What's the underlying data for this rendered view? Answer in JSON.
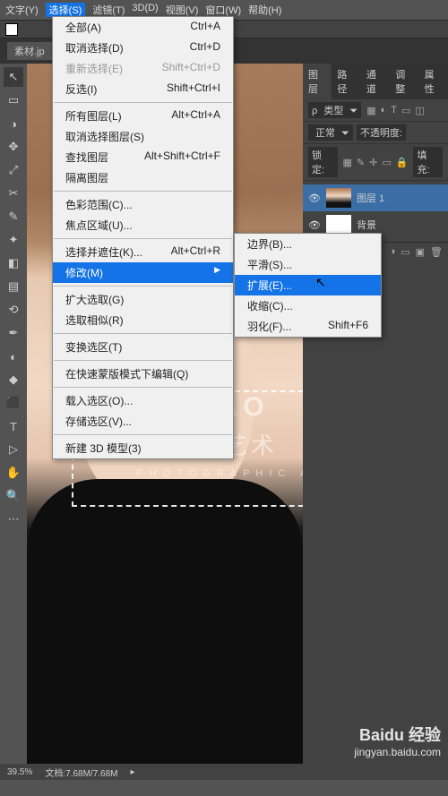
{
  "menubar": {
    "items": [
      "文字(Y)",
      "选择(S)",
      "滤镜(T)",
      "3D(D)",
      "视图(V)",
      "窗口(W)",
      "帮助(H)"
    ],
    "active_index": 1
  },
  "document_tab": "素材.jp",
  "select_menu": {
    "items": [
      {
        "label": "全部(A)",
        "shortcut": "Ctrl+A"
      },
      {
        "label": "取消选择(D)",
        "shortcut": "Ctrl+D"
      },
      {
        "label": "重新选择(E)",
        "shortcut": "Shift+Ctrl+D",
        "disabled": true
      },
      {
        "label": "反选(I)",
        "shortcut": "Shift+Ctrl+I"
      },
      {
        "sep": true
      },
      {
        "label": "所有图层(L)",
        "shortcut": "Alt+Ctrl+A"
      },
      {
        "label": "取消选择图层(S)"
      },
      {
        "label": "查找图层",
        "shortcut": "Alt+Shift+Ctrl+F"
      },
      {
        "label": "隔离图层"
      },
      {
        "sep": true
      },
      {
        "label": "色彩范围(C)..."
      },
      {
        "label": "焦点区域(U)..."
      },
      {
        "sep": true
      },
      {
        "label": "选择并遮住(K)...",
        "shortcut": "Alt+Ctrl+R"
      },
      {
        "label": "修改(M)",
        "submenu": true,
        "highlight": true
      },
      {
        "sep": true
      },
      {
        "label": "扩大选取(G)"
      },
      {
        "label": "选取相似(R)"
      },
      {
        "sep": true
      },
      {
        "label": "变换选区(T)"
      },
      {
        "sep": true
      },
      {
        "label": "在快速蒙版模式下编辑(Q)"
      },
      {
        "sep": true
      },
      {
        "label": "载入选区(O)..."
      },
      {
        "label": "存储选区(V)..."
      },
      {
        "sep": true
      },
      {
        "label": "新建 3D 模型(3)"
      }
    ]
  },
  "modify_submenu": {
    "items": [
      {
        "label": "边界(B)..."
      },
      {
        "label": "平滑(S)..."
      },
      {
        "label": "扩展(E)...",
        "highlight": true
      },
      {
        "label": "收缩(C)..."
      },
      {
        "label": "羽化(F)...",
        "shortcut": "Shift+F6"
      }
    ]
  },
  "panels": {
    "tabs": [
      "图层",
      "路径",
      "通道",
      "调整",
      "属性"
    ],
    "active_tab": 0,
    "kind_label": "类型",
    "blend_mode": "正常",
    "opacity_label": "不透明度:",
    "lock_label": "锁定:",
    "fill_label": "填充:",
    "layers": [
      {
        "name": "图层 1",
        "visible": true,
        "current": true
      },
      {
        "name": "背景",
        "visible": true,
        "current": false
      }
    ]
  },
  "watermark": {
    "line1": "IAO",
    "line2": "影艺术",
    "line3": "PHOTOGRAPHIC ART"
  },
  "status": {
    "zoom": "39.5%",
    "doc": "文档:7.68M/7.68M"
  },
  "baidu": {
    "brand": "Baidu 经验",
    "url": "jingyan.baidu.com"
  },
  "tools": [
    "↖",
    "▭",
    "◑",
    "✥",
    "⤢",
    "✂",
    "✎",
    "✦",
    "◧",
    "▤",
    "⟲",
    "✒",
    "◐",
    "◆",
    "⬛",
    "T",
    "▷",
    "✋",
    "🔍",
    "⋯"
  ]
}
